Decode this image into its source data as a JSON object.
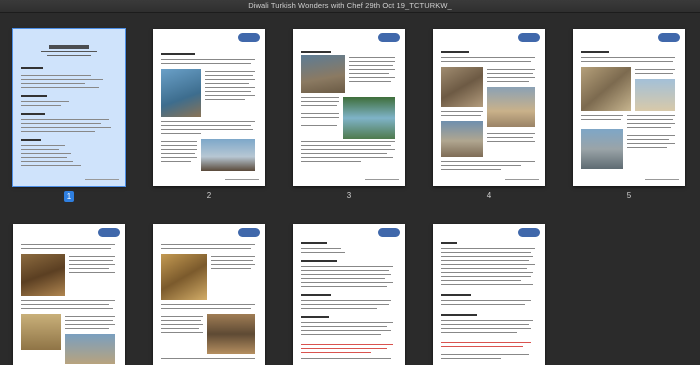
{
  "window": {
    "title": "Diwali Turkish Wonders with Chef 29th Oct 19_TCTURKW_"
  },
  "pages": [
    {
      "number": "1",
      "selected": true
    },
    {
      "number": "2",
      "selected": false
    },
    {
      "number": "3",
      "selected": false
    },
    {
      "number": "4",
      "selected": false
    },
    {
      "number": "5",
      "selected": false
    },
    {
      "number": "",
      "selected": false
    },
    {
      "number": "",
      "selected": false
    },
    {
      "number": "",
      "selected": false
    },
    {
      "number": "",
      "selected": false
    }
  ],
  "colors": {
    "background": "#2b2b2b",
    "selection": "#2f7fe0",
    "selected_page": "#cfe3fb"
  }
}
